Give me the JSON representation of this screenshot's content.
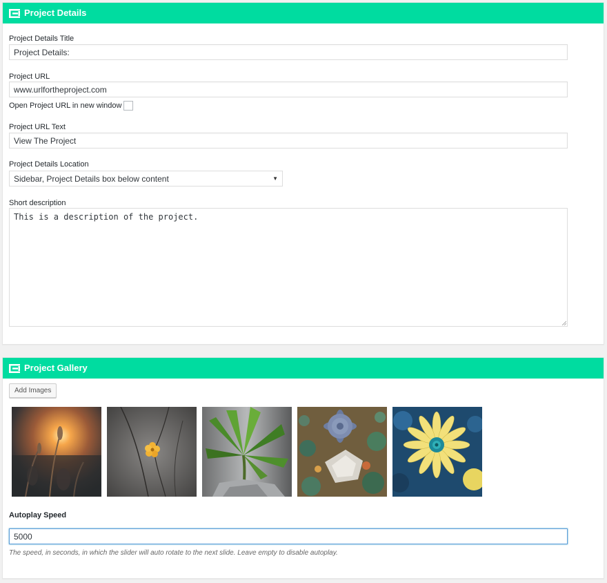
{
  "project_details": {
    "header_title": "Project Details",
    "header_icon": "layout-icon",
    "title_label": "Project Details Title",
    "title_value": "Project Details:",
    "url_label": "Project URL",
    "url_value": "www.urlfortheproject.com",
    "new_window_label": "Open Project URL in new window",
    "new_window_checked": false,
    "url_text_label": "Project URL Text",
    "url_text_value": "View The Project",
    "location_label": "Project Details Location",
    "location_selected": "Sidebar, Project Details box below content",
    "short_desc_label": "Short description",
    "short_desc_value": "This is a description of the project."
  },
  "project_gallery": {
    "header_title": "Project Gallery",
    "header_icon": "layout-icon",
    "add_images_label": "Add Images",
    "images": [
      {
        "name": "sunset-grass-image"
      },
      {
        "name": "yellow-flower-image"
      },
      {
        "name": "palm-plant-image"
      },
      {
        "name": "succulents-image"
      },
      {
        "name": "yellow-daisy-image"
      }
    ],
    "autoplay_label": "Autoplay Speed",
    "autoplay_value": "5000",
    "autoplay_help": "The speed, in seconds, in which the slider will auto rotate to the next slide. Leave empty to disable autoplay."
  },
  "colors": {
    "header_bg": "#00dca0",
    "header_text": "#ffffff",
    "focus_border": "#5b9dd9"
  }
}
